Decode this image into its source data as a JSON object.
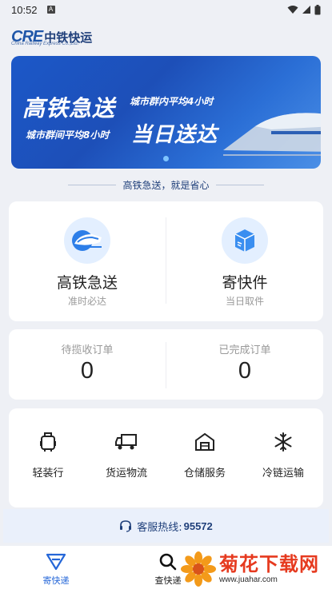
{
  "status_bar": {
    "time": "10:52",
    "badge": "A"
  },
  "logo": {
    "mark": "CRE",
    "name_cn": "中铁快运",
    "name_en": "China Railway Express Co.,Ltd."
  },
  "banner": {
    "headline_1": "高铁急送",
    "headline_2": "城市群内平均4小时",
    "headline_3": "城市群间平均8小时",
    "headline_4": "当日送达"
  },
  "slogan": "高铁急送，就是省心",
  "services": [
    {
      "title": "高铁急送",
      "subtitle": "准时必达",
      "icon": "train-icon"
    },
    {
      "title": "寄快件",
      "subtitle": "当日取件",
      "icon": "package-icon"
    }
  ],
  "orders": [
    {
      "label": "待揽收订单",
      "count": "0"
    },
    {
      "label": "已完成订单",
      "count": "0"
    }
  ],
  "tools": [
    {
      "label": "轻装行",
      "icon": "luggage-icon"
    },
    {
      "label": "货运物流",
      "icon": "truck-icon"
    },
    {
      "label": "仓储服务",
      "icon": "warehouse-icon"
    },
    {
      "label": "冷链运输",
      "icon": "snowflake-icon"
    }
  ],
  "hotline": {
    "label": "客服热线:",
    "number": "95572"
  },
  "bottom_nav": [
    {
      "label": "寄快递",
      "icon": "send-icon",
      "active": true
    },
    {
      "label": "查快递",
      "icon": "search-icon",
      "active": false
    }
  ],
  "watermark": {
    "title": "菊花下载网",
    "url": "www.juahar.com"
  },
  "colors": {
    "accent": "#2567d8",
    "brand_dark": "#1f3f7a",
    "background": "#eef0f5"
  }
}
